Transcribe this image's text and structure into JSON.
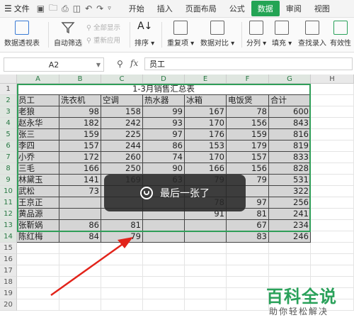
{
  "menubar": {
    "file_label": "文件",
    "tabs": [
      {
        "label": "开始"
      },
      {
        "label": "插入"
      },
      {
        "label": "页面布局"
      },
      {
        "label": "公式"
      },
      {
        "label": "数据"
      },
      {
        "label": "审阅"
      },
      {
        "label": "视图"
      }
    ],
    "active_tab": "数据",
    "accent_color": "#23a454"
  },
  "ribbon": {
    "pivot_label": "数据透视表",
    "autofilter_label": "自动筛选",
    "show_all_label": "全部显示",
    "reapply_label": "重新应用",
    "sort_label": "排序",
    "duplicates_label": "重复项",
    "compare_label": "数据对比",
    "split_label": "分列",
    "fill_label": "填充",
    "lookup_label": "查找录入",
    "validity_label": "有效性"
  },
  "formula_bar": {
    "name_box": "A2",
    "fx_label": "fx",
    "value": "员工"
  },
  "sheet": {
    "columns": [
      "A",
      "B",
      "C",
      "D",
      "E",
      "F",
      "G",
      "H"
    ],
    "rows": [
      "1",
      "2",
      "3",
      "4",
      "5",
      "6",
      "7",
      "8",
      "9",
      "10",
      "11",
      "12",
      "13",
      "14",
      "15",
      "16",
      "17",
      "18",
      "19",
      "20"
    ],
    "title": "1-3月销售汇总表",
    "headers": [
      "员工",
      "洗衣机",
      "空调",
      "热水器",
      "冰箱",
      "电饭煲",
      "合计"
    ],
    "data": [
      [
        "老狼",
        "98",
        "158",
        "99",
        "167",
        "78",
        "600"
      ],
      [
        "赵永华",
        "182",
        "242",
        "93",
        "170",
        "156",
        "843"
      ],
      [
        "张三",
        "159",
        "225",
        "97",
        "176",
        "159",
        "816"
      ],
      [
        "李四",
        "157",
        "244",
        "86",
        "153",
        "179",
        "819"
      ],
      [
        "小乔",
        "172",
        "260",
        "74",
        "170",
        "157",
        "833"
      ],
      [
        "三毛",
        "166",
        "250",
        "90",
        "166",
        "156",
        "828"
      ],
      [
        "林黛玉",
        "141",
        "169",
        "63",
        "79",
        "79",
        "531"
      ],
      [
        "武松",
        "73",
        "",
        "",
        "",
        "",
        "322"
      ],
      [
        "王京正",
        "",
        "",
        "",
        "78",
        "97",
        "256"
      ],
      [
        "黄品源",
        "",
        "",
        "",
        "91",
        "81",
        "241"
      ],
      [
        "张靳娲",
        "86",
        "81",
        "",
        "",
        "67",
        "234"
      ],
      [
        "陈红梅",
        "84",
        "79",
        "",
        "",
        "83",
        "246"
      ]
    ]
  },
  "toast": {
    "message": "最后一张了"
  },
  "watermark": {
    "brand": "百科全说",
    "slogan": "助你轻松解决"
  }
}
